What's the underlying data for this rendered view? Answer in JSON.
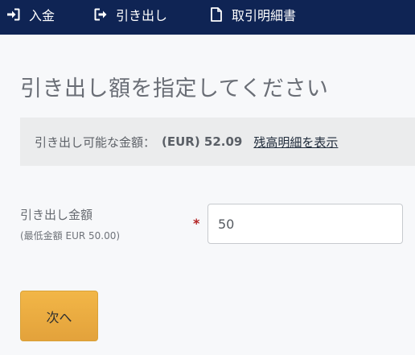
{
  "nav": {
    "deposit_label": "入金",
    "deposit_icon": "sign-in-icon",
    "withdraw_label": "引き出し",
    "withdraw_icon": "sign-out-icon",
    "statement_label": "取引明細書",
    "statement_icon": "document-icon",
    "background": "#0f2454"
  },
  "page": {
    "title": "引き出し額を指定してください"
  },
  "info": {
    "available_label": "引き出し可能な金額：",
    "available_amount": "(EUR) 52.09",
    "balance_link": "残高明細を表示"
  },
  "form": {
    "amount_label": "引き出し金額",
    "amount_min_note": "(最低金額 EUR 50.00)",
    "required_mark": "*",
    "amount_value": "50"
  },
  "actions": {
    "next_label": "次へ",
    "accent": "#f0b445"
  }
}
